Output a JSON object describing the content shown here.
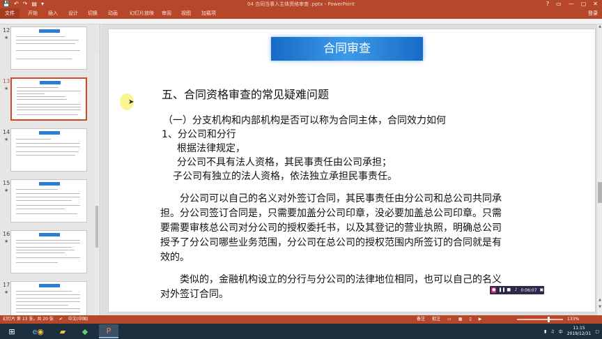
{
  "window": {
    "title": "04 合同当事人主体资格审查 .pptx - PowerPoint",
    "quick_access": [
      "💾",
      "↶",
      "↷",
      "▤",
      "▾"
    ],
    "controls": [
      "?",
      "▭",
      "—",
      "▢",
      "✕"
    ]
  },
  "ribbon": {
    "tabs": [
      "文件",
      "开始",
      "插入",
      "设计",
      "切换",
      "动画",
      "幻灯片放映",
      "审阅",
      "视图",
      "加载项"
    ],
    "login": "登录"
  },
  "thumbnails": [
    {
      "num": "12",
      "star": "★"
    },
    {
      "num": "13",
      "star": "★"
    },
    {
      "num": "14",
      "star": "★"
    },
    {
      "num": "15",
      "star": "★"
    },
    {
      "num": "16",
      "star": "★"
    },
    {
      "num": "17",
      "star": "★"
    }
  ],
  "slide": {
    "banner": "合同审查",
    "heading": "五、合同资格审查的常见疑难问题",
    "lines": [
      "（一）分支机构和内部机构是否可以称为合同主体，合同效力如何",
      "1、分公司和分行",
      "根据法律规定，",
      "分公司不具有法人资格，其民事责任由公司承担；",
      "子公司有独立的法人资格，依法独立承担民事责任。",
      "分公司可以自己的名义对外签订合同，其民事责任由分公司和总公司共同承",
      "担。分公司签订合同是，只需要加盖分公司印章，没必要加盖总公司印章。只需",
      "要需要审核总公司对分公司的授权委托书，以及其登记的营业执照，明确总公司",
      "授予了分公司哪些业务范围，分公司在总公司的授权范围内所签订的合同就是有",
      "效的。",
      "类似的，金融机构设立的分行与分公司的法律地位相同，也可以自己的名义",
      "对外签订合同。"
    ]
  },
  "recorder": {
    "time": "0:06:07"
  },
  "status": {
    "slide_info": "幻灯片 第 13 张，共 20 张",
    "language": "中文(中国)",
    "notes": "备注",
    "comments": "批注",
    "zoom": "133%"
  },
  "taskbar": {
    "start": "⊞",
    "apps": [
      "e",
      "◉",
      "▰",
      "◆",
      "P"
    ],
    "time": "11:15",
    "date": "2019/12/31"
  }
}
